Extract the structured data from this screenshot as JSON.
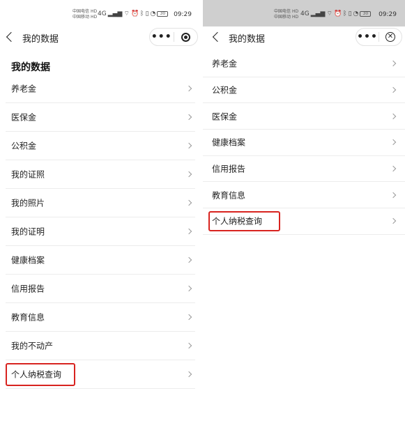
{
  "status_bar": {
    "carrier_1": "中国电信",
    "carrier_2": "中国移动",
    "network_1": "HD",
    "network_2": "HD",
    "signal": "4G",
    "battery": "30",
    "time": "09:29"
  },
  "left_screen": {
    "nav": {
      "title": "我的数据",
      "more_label": "•••"
    },
    "heading": "我的数据",
    "items": [
      {
        "label": "养老金"
      },
      {
        "label": "医保金"
      },
      {
        "label": "公积金"
      },
      {
        "label": "我的证照"
      },
      {
        "label": "我的照片"
      },
      {
        "label": "我的证明"
      },
      {
        "label": "健康档案"
      },
      {
        "label": "信用报告"
      },
      {
        "label": "教育信息"
      },
      {
        "label": "我的不动产"
      },
      {
        "label": "个人纳税查询"
      }
    ],
    "highlighted_item": "个人纳税查询"
  },
  "right_screen": {
    "nav": {
      "title": "我的数据",
      "more_label": "•••",
      "close_label": "✕"
    },
    "items": [
      {
        "label": "养老金"
      },
      {
        "label": "公积金"
      },
      {
        "label": "医保金"
      },
      {
        "label": "健康档案"
      },
      {
        "label": "信用报告"
      },
      {
        "label": "教育信息"
      },
      {
        "label": "个人纳税查询"
      }
    ],
    "highlighted_item": "个人纳税查询"
  },
  "colors": {
    "highlight_border": "#d8231f",
    "right_statusbar_bg": "#cfcfcf"
  }
}
